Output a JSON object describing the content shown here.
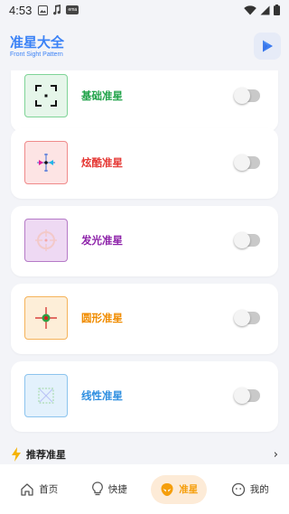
{
  "status_bar": {
    "time": "4:53",
    "badge": "ema"
  },
  "header": {
    "title": "准星大全",
    "subtitle": "Front Sight Pattern"
  },
  "crosshairs": [
    {
      "label": "基础准星",
      "icon": "basic-crosshair-icon",
      "color": "#22a34a",
      "bg": "#e6f6ea",
      "border": "#7fd497",
      "enabled": false
    },
    {
      "label": "炫酷准星",
      "icon": "cool-crosshair-icon",
      "color": "#e53935",
      "bg": "#fde4e4",
      "border": "#f08a8a",
      "enabled": false
    },
    {
      "label": "发光准星",
      "icon": "glow-crosshair-icon",
      "color": "#8e24aa",
      "bg": "#eed9f3",
      "border": "#b57ac7",
      "enabled": false
    },
    {
      "label": "圆形准星",
      "icon": "circle-crosshair-icon",
      "color": "#f08c00",
      "bg": "#fdeed8",
      "border": "#f5b35a",
      "enabled": false
    },
    {
      "label": "线性准星",
      "icon": "linear-crosshair-icon",
      "color": "#2f8fe0",
      "bg": "#e3f1fc",
      "border": "#8cc4ee",
      "enabled": false
    }
  ],
  "recommend": {
    "label": "推荐准星",
    "icon": "lightning-icon"
  },
  "nav": [
    {
      "label": "首页",
      "icon": "home-icon",
      "active": false
    },
    {
      "label": "快捷",
      "icon": "bulb-icon",
      "active": false
    },
    {
      "label": "准星",
      "icon": "alien-icon",
      "active": true
    },
    {
      "label": "我的",
      "icon": "smile-icon",
      "active": false
    }
  ],
  "colors": {
    "accent": "#3b82f6",
    "active_nav": "#f59e0b"
  }
}
